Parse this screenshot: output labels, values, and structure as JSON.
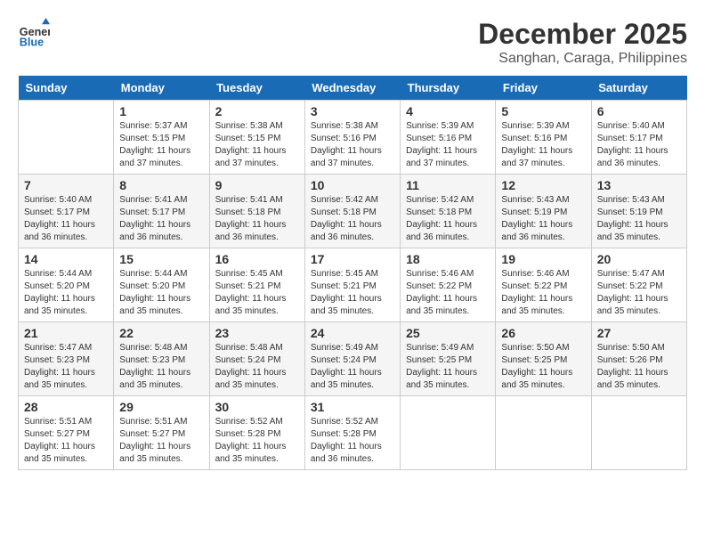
{
  "header": {
    "logo_line1": "General",
    "logo_line2": "Blue",
    "month": "December 2025",
    "location": "Sanghan, Caraga, Philippines"
  },
  "days_of_week": [
    "Sunday",
    "Monday",
    "Tuesday",
    "Wednesday",
    "Thursday",
    "Friday",
    "Saturday"
  ],
  "weeks": [
    [
      {
        "day": "",
        "info": ""
      },
      {
        "day": "1",
        "info": "Sunrise: 5:37 AM\nSunset: 5:15 PM\nDaylight: 11 hours\nand 37 minutes."
      },
      {
        "day": "2",
        "info": "Sunrise: 5:38 AM\nSunset: 5:15 PM\nDaylight: 11 hours\nand 37 minutes."
      },
      {
        "day": "3",
        "info": "Sunrise: 5:38 AM\nSunset: 5:16 PM\nDaylight: 11 hours\nand 37 minutes."
      },
      {
        "day": "4",
        "info": "Sunrise: 5:39 AM\nSunset: 5:16 PM\nDaylight: 11 hours\nand 37 minutes."
      },
      {
        "day": "5",
        "info": "Sunrise: 5:39 AM\nSunset: 5:16 PM\nDaylight: 11 hours\nand 37 minutes."
      },
      {
        "day": "6",
        "info": "Sunrise: 5:40 AM\nSunset: 5:17 PM\nDaylight: 11 hours\nand 36 minutes."
      }
    ],
    [
      {
        "day": "7",
        "info": "Sunrise: 5:40 AM\nSunset: 5:17 PM\nDaylight: 11 hours\nand 36 minutes."
      },
      {
        "day": "8",
        "info": "Sunrise: 5:41 AM\nSunset: 5:17 PM\nDaylight: 11 hours\nand 36 minutes."
      },
      {
        "day": "9",
        "info": "Sunrise: 5:41 AM\nSunset: 5:18 PM\nDaylight: 11 hours\nand 36 minutes."
      },
      {
        "day": "10",
        "info": "Sunrise: 5:42 AM\nSunset: 5:18 PM\nDaylight: 11 hours\nand 36 minutes."
      },
      {
        "day": "11",
        "info": "Sunrise: 5:42 AM\nSunset: 5:18 PM\nDaylight: 11 hours\nand 36 minutes."
      },
      {
        "day": "12",
        "info": "Sunrise: 5:43 AM\nSunset: 5:19 PM\nDaylight: 11 hours\nand 36 minutes."
      },
      {
        "day": "13",
        "info": "Sunrise: 5:43 AM\nSunset: 5:19 PM\nDaylight: 11 hours\nand 35 minutes."
      }
    ],
    [
      {
        "day": "14",
        "info": "Sunrise: 5:44 AM\nSunset: 5:20 PM\nDaylight: 11 hours\nand 35 minutes."
      },
      {
        "day": "15",
        "info": "Sunrise: 5:44 AM\nSunset: 5:20 PM\nDaylight: 11 hours\nand 35 minutes."
      },
      {
        "day": "16",
        "info": "Sunrise: 5:45 AM\nSunset: 5:21 PM\nDaylight: 11 hours\nand 35 minutes."
      },
      {
        "day": "17",
        "info": "Sunrise: 5:45 AM\nSunset: 5:21 PM\nDaylight: 11 hours\nand 35 minutes."
      },
      {
        "day": "18",
        "info": "Sunrise: 5:46 AM\nSunset: 5:22 PM\nDaylight: 11 hours\nand 35 minutes."
      },
      {
        "day": "19",
        "info": "Sunrise: 5:46 AM\nSunset: 5:22 PM\nDaylight: 11 hours\nand 35 minutes."
      },
      {
        "day": "20",
        "info": "Sunrise: 5:47 AM\nSunset: 5:22 PM\nDaylight: 11 hours\nand 35 minutes."
      }
    ],
    [
      {
        "day": "21",
        "info": "Sunrise: 5:47 AM\nSunset: 5:23 PM\nDaylight: 11 hours\nand 35 minutes."
      },
      {
        "day": "22",
        "info": "Sunrise: 5:48 AM\nSunset: 5:23 PM\nDaylight: 11 hours\nand 35 minutes."
      },
      {
        "day": "23",
        "info": "Sunrise: 5:48 AM\nSunset: 5:24 PM\nDaylight: 11 hours\nand 35 minutes."
      },
      {
        "day": "24",
        "info": "Sunrise: 5:49 AM\nSunset: 5:24 PM\nDaylight: 11 hours\nand 35 minutes."
      },
      {
        "day": "25",
        "info": "Sunrise: 5:49 AM\nSunset: 5:25 PM\nDaylight: 11 hours\nand 35 minutes."
      },
      {
        "day": "26",
        "info": "Sunrise: 5:50 AM\nSunset: 5:25 PM\nDaylight: 11 hours\nand 35 minutes."
      },
      {
        "day": "27",
        "info": "Sunrise: 5:50 AM\nSunset: 5:26 PM\nDaylight: 11 hours\nand 35 minutes."
      }
    ],
    [
      {
        "day": "28",
        "info": "Sunrise: 5:51 AM\nSunset: 5:27 PM\nDaylight: 11 hours\nand 35 minutes."
      },
      {
        "day": "29",
        "info": "Sunrise: 5:51 AM\nSunset: 5:27 PM\nDaylight: 11 hours\nand 35 minutes."
      },
      {
        "day": "30",
        "info": "Sunrise: 5:52 AM\nSunset: 5:28 PM\nDaylight: 11 hours\nand 35 minutes."
      },
      {
        "day": "31",
        "info": "Sunrise: 5:52 AM\nSunset: 5:28 PM\nDaylight: 11 hours\nand 36 minutes."
      },
      {
        "day": "",
        "info": ""
      },
      {
        "day": "",
        "info": ""
      },
      {
        "day": "",
        "info": ""
      }
    ]
  ]
}
